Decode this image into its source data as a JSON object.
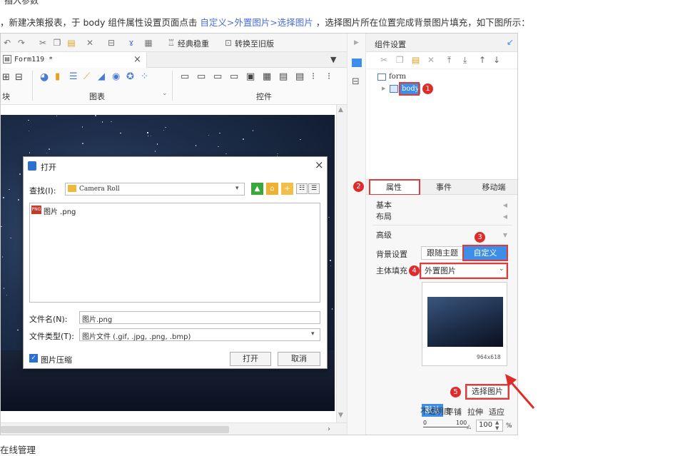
{
  "doc": {
    "top_text": "插入参数",
    "intro_before": "，新建决策报表，于 body 组件属性设置页面点击 ",
    "intro_link": "自定义>外置图片>选择图片",
    "intro_after": " ，选择图片所在位置完成背景图片填充，如下图所示：",
    "footer": "在线管理"
  },
  "toolbar": {
    "classic_theme": "经典稳重",
    "switch_old": "转换至旧版"
  },
  "tab": {
    "title": "Form119 *",
    "close": "×"
  },
  "ribbon": {
    "block": "块",
    "chart": "图表",
    "control": "控件"
  },
  "dialog": {
    "title": "打开",
    "lookin_label": "查找(I):",
    "lookin_value": "Camera Roll",
    "file_item": "图片 .png",
    "filename_label": "文件名(N):",
    "filename_value": "图片.png",
    "filetype_label": "文件类型(T):",
    "filetype_value": "图片文件 (.gif, .jpg, .png, .bmp)",
    "compress": "图片压缩",
    "open": "打开",
    "cancel": "取消",
    "close": "×"
  },
  "panel": {
    "title": "组件设置",
    "tree_form": "form",
    "tree_body": "body",
    "tabs": [
      "属性",
      "事件",
      "移动端"
    ],
    "sections": {
      "basic": "基本",
      "layout": "布局",
      "advanced": "高级"
    },
    "bg_setting_label": "背景设置",
    "follow_theme": "跟随主题",
    "custom": "自定义",
    "fill_label": "主体填充",
    "fill_value": "外置图片",
    "image_size": "964x618",
    "fit_modes": [
      "默认",
      "平铺",
      "拉伸",
      "适应"
    ],
    "choose_image": "选择图片",
    "opacity_label": "不透明度",
    "opacity_min": "0",
    "opacity_max": "100",
    "opacity_value": "100",
    "opacity_unit": "%"
  },
  "badges": [
    "1",
    "2",
    "3",
    "4",
    "5"
  ],
  "colors": {
    "accent": "#3d8ee8",
    "annotation": "#e02b2b",
    "link": "#4a6ee0"
  }
}
